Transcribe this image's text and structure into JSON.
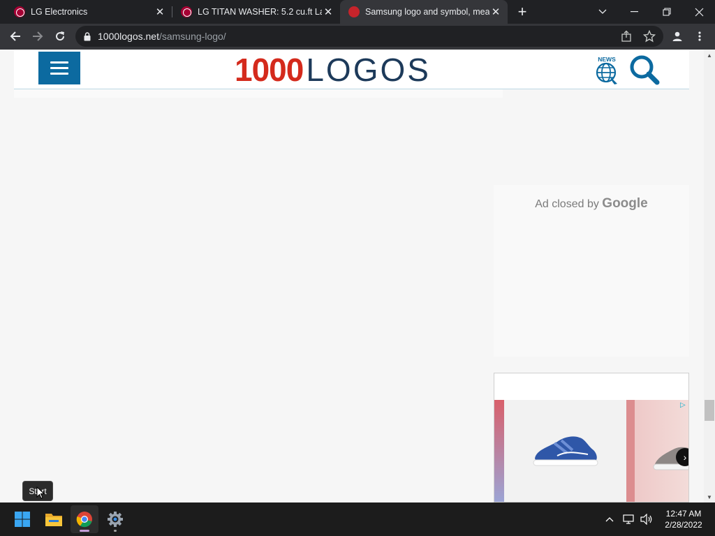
{
  "tabs": [
    {
      "title": "LG Electronics",
      "favicon": "lg-favicon",
      "active": false
    },
    {
      "title": "LG TITAN WASHER: 5.2 cu.ft Larg",
      "favicon": "lg-favicon",
      "active": false
    },
    {
      "title": "Samsung logo and symbol, mea",
      "favicon": "samsung-favicon",
      "active": true
    }
  ],
  "toolbar": {
    "url_domain": "1000logos.net",
    "url_path": "/samsung-logo/"
  },
  "site": {
    "logo_number": "1000",
    "logo_word": "LOGOS",
    "news_label": "NEWS",
    "brand_color": "#d42a1c",
    "nav_color": "#0c6aa0"
  },
  "ad": {
    "closed_text": "Ad closed by",
    "closed_brand": "Google"
  },
  "taskbar": {
    "tooltip": "Start",
    "time": "12:47 AM",
    "date": "2/28/2022"
  }
}
